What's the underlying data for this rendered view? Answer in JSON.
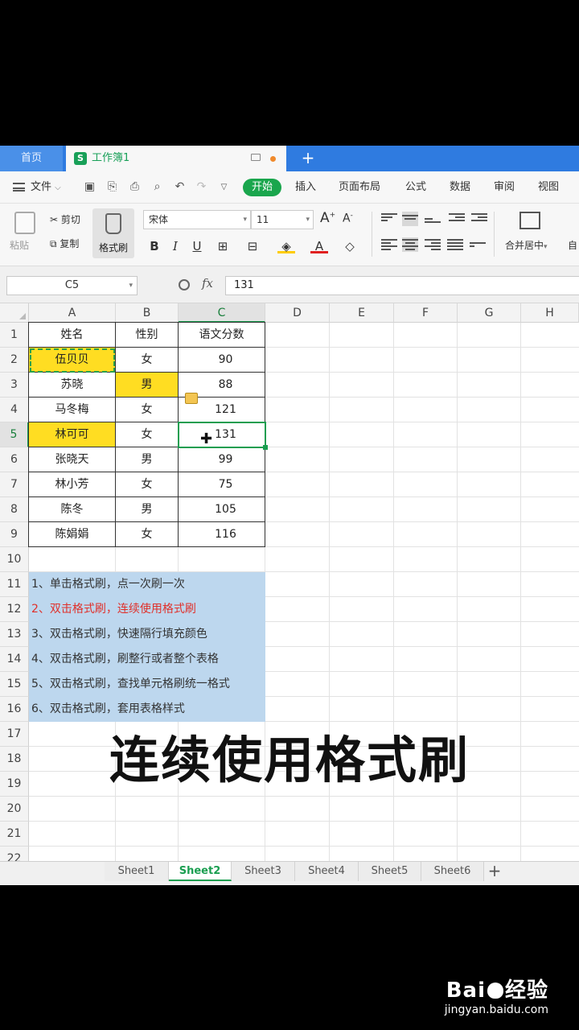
{
  "titlebar": {
    "home_tab": "首页",
    "book_logo": "S",
    "book_title": "工作簿1",
    "add_tab": "+"
  },
  "menubar": {
    "file": "文件",
    "tabs": [
      "开始",
      "插入",
      "页面布局",
      "公式",
      "数据",
      "审阅",
      "视图"
    ]
  },
  "ribbon": {
    "paste": "粘贴",
    "cut": "剪切",
    "copy": "复制",
    "format_painter": "格式刷",
    "font_name": "宋体",
    "font_size": "11",
    "merge_center": "合并居中",
    "auto": "自"
  },
  "formula_bar": {
    "name_box": "C5",
    "fx": "fx",
    "value": "131"
  },
  "grid": {
    "columns": [
      "A",
      "B",
      "C",
      "D",
      "E",
      "F",
      "G",
      "H"
    ],
    "rows": [
      "1",
      "2",
      "3",
      "4",
      "5",
      "6",
      "7",
      "8",
      "9",
      "10",
      "11",
      "12",
      "13",
      "14",
      "15",
      "16",
      "17",
      "18",
      "19",
      "20",
      "21",
      "22"
    ],
    "table": {
      "header": [
        "姓名",
        "性别",
        "语文分数"
      ],
      "rows": [
        [
          "伍贝贝",
          "女",
          "90"
        ],
        [
          "苏晓",
          "男",
          "88"
        ],
        [
          "马冬梅",
          "女",
          "121"
        ],
        [
          "林可可",
          "女",
          "131"
        ],
        [
          "张晓天",
          "男",
          "99"
        ],
        [
          "林小芳",
          "女",
          "75"
        ],
        [
          "陈冬",
          "男",
          "105"
        ],
        [
          "陈娟娟",
          "女",
          "116"
        ]
      ]
    },
    "notes": [
      "1、单击格式刷，点一次刷一次",
      "2、双击格式刷，连续使用格式刷",
      "3、双击格式刷，快速隔行填充颜色",
      "4、双击格式刷，刷整行或者整个表格",
      "5、双击格式刷，查找单元格刷统一格式",
      "6、双击格式刷，套用表格样式"
    ]
  },
  "sheets": [
    "Sheet1",
    "Sheet2",
    "Sheet3",
    "Sheet4",
    "Sheet5",
    "Sheet6"
  ],
  "active_sheet": "Sheet2",
  "caption": "连续使用格式刷",
  "watermark": {
    "logo_left": "Bai",
    "logo_right": "经验",
    "url": "jingyan.baidu.com"
  },
  "colors": {
    "accent": "#1aa64d",
    "titlebar": "#2f7be0",
    "highlight": "#ffdd22",
    "note_bg": "#bdd7ee",
    "note_red": "#e0302a"
  }
}
